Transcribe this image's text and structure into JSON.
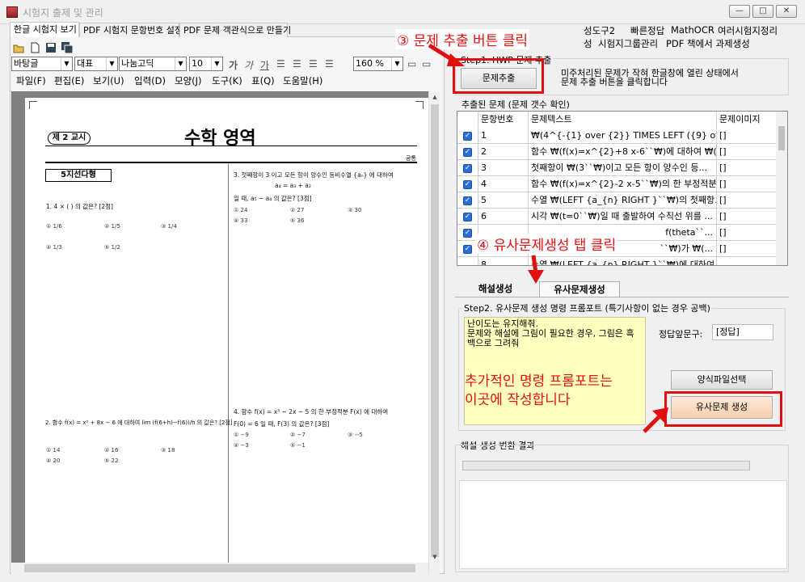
{
  "window": {
    "title": "시험지 출제 및 관리",
    "min": "—",
    "max": "□",
    "close": "✕"
  },
  "left_tabs": [
    "한글 시험지 보기",
    "PDF 시험지 문항번호 설정",
    "PDF 문제 객관식으로 만들기"
  ],
  "font_bar": {
    "style": "바탕글",
    "style2": "대표",
    "font": "나눔고딕",
    "size": "10",
    "bold": "가",
    "italic": "가",
    "underline": "가",
    "zoom": "160 %"
  },
  "menu": [
    "파일(F)",
    "편집(E)",
    "보기(U)",
    "입력(D)",
    "모양(J)",
    "도구(K)",
    "표(Q)",
    "도움말(H)"
  ],
  "doc": {
    "kyosi": "제 2 교시",
    "subject": "수학 영역",
    "topright": "공통",
    "qtitle": "5지선다형",
    "q1": "1.  4  × (   )  의 값은? [2점]",
    "q1_opts": [
      "① 1/6",
      "② 1/5",
      "③ 1/4",
      "④ 1/3",
      "⑤ 1/2"
    ],
    "q2": "2. 함수 f(x) = x² + 8x − 6 에 대하여 lim (f(6+h)−f(6))/h 의 값은? [2점]",
    "q2_opts": [
      "① 14",
      "② 16",
      "③ 18",
      "④ 20",
      "⑤ 22"
    ],
    "q3a": "3. 첫째항이 3 이고 모든 항이 양수인 등비수열 {aₙ} 에 대하여",
    "q3b": "a₄ = a₃ + a₂",
    "q3c": "일 때, a₅ − a₄ 의 값은? [3점]",
    "q3_opts": [
      "① 24",
      "② 27",
      "③ 30",
      "④ 33",
      "⑤ 36"
    ],
    "q4a": "4. 함수 f(x) = x³ − 2x − 5 의 한 부정적분 F(x) 에 대하여",
    "q4b": "F(0) = 6 일 때, F(3) 의 값은? [3점]",
    "q4_opts": [
      "① −9",
      "② −7",
      "③ −5",
      "④ −3",
      "⑤ −1"
    ]
  },
  "right_tabs": [
    "성도구2",
    "빠른정답",
    "MathOCR",
    "여러시험지정리",
    "성",
    "시험지그룹관리",
    "PDF 책에서 과제생성"
  ],
  "step1": {
    "label": "Step1. HWP 문제 추출",
    "button": "문제추출",
    "hint1": "미주처리된 문제가 작혀 한글창에 열린 상태에서",
    "hint2": "문제 추출 버튼을 클릭합니다"
  },
  "extracted": {
    "label": "추출된 문제 (문제 갯수 확인)",
    "headers": [
      "문항번호",
      "문제텍스트",
      "문제이미지"
    ],
    "rows": [
      {
        "num": "1",
        "text": "₩(4^{-{1} over {2}} TIMES LEFT ({9} ove...",
        "img": "[]"
      },
      {
        "num": "2",
        "text": "함수 ₩(f(x)=x^{2}+8 x-6``₩)에 대하여 ₩(li...",
        "img": "[]"
      },
      {
        "num": "3",
        "text": "첫째항이 ₩(3``₩)이고 모든 항이 양수인 등...",
        "img": "[]"
      },
      {
        "num": "4",
        "text": "함수 ₩(f(x)=x^{2}-2 x-5``₩)의 한 부정적분...",
        "img": "[]"
      },
      {
        "num": "5",
        "text": "수열 ₩(LEFT {a_{n} RIGHT }``₩)의 첫째항...",
        "img": "[]"
      },
      {
        "num": "6",
        "text": "시각 ₩(t=0``₩)일 때 출발하여 수직선 위를 ...",
        "img": "[]"
      },
      {
        "num": "",
        "text": "f(theta``...",
        "img": "[]"
      },
      {
        "num": "",
        "text": "``₩)가 ₩(...",
        "img": "[]"
      },
      {
        "num": "8",
        "text": "수열 ₩(LEFT {a_{n} RIGHT }``₩)에 대하여",
        "img": ""
      }
    ]
  },
  "bottom_tabs": [
    "해설생성",
    "유사문제생성"
  ],
  "step2": {
    "label": "Step2. 유사문제 생성 명령 프롬포트 (특기사항이 없는 경우 공백)",
    "prompt_lines": [
      "난이도는 유지해줘.",
      "문제와 해설에 그림이 필요한 경우, 그림은 흑",
      "백으로 그려줘"
    ],
    "answer_prefix_label": "정답앞문구:",
    "answer_prefix_value": "[정답]",
    "template_button": "양식파일선택",
    "generate_button": "유사문제 생성"
  },
  "result_label": "해설 생성 변환 결과",
  "annotations": {
    "a3": "③ 문제 추출 버튼 클릭",
    "a4": "④ 유사문제생성 탭 클릭",
    "a5a": "추가적인 명령 프롬포트는",
    "a5b": "이곳에  작성합니다"
  },
  "colors": {
    "annotation": "#e01010",
    "checkbox": "#2a6fd6",
    "prompt_bg": "#ffffc0"
  }
}
